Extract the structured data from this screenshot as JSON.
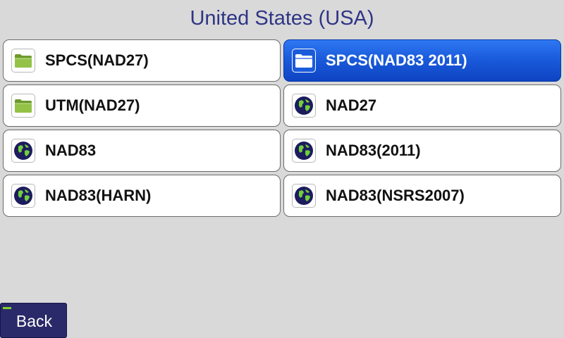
{
  "page": {
    "title": "United States (USA)"
  },
  "items": [
    {
      "label": "SPCS(NAD27)",
      "icon": "folder-icon",
      "selected": false
    },
    {
      "label": "SPCS(NAD83 2011)",
      "icon": "folder-icon",
      "selected": true
    },
    {
      "label": "UTM(NAD27)",
      "icon": "folder-icon",
      "selected": false
    },
    {
      "label": "NAD27",
      "icon": "globe-icon",
      "selected": false
    },
    {
      "label": "NAD83",
      "icon": "globe-icon",
      "selected": false
    },
    {
      "label": "NAD83(2011)",
      "icon": "globe-icon",
      "selected": false
    },
    {
      "label": "NAD83(HARN)",
      "icon": "globe-icon",
      "selected": false
    },
    {
      "label": "NAD83(NSRS2007)",
      "icon": "globe-icon",
      "selected": false
    }
  ],
  "footer": {
    "back_label": "Back"
  },
  "colors": {
    "background": "#d9d9d9",
    "title": "#2f3585",
    "selected": "#1a5bdc",
    "back_button": "#2a2a6a",
    "indicator": "#7fd12b"
  }
}
